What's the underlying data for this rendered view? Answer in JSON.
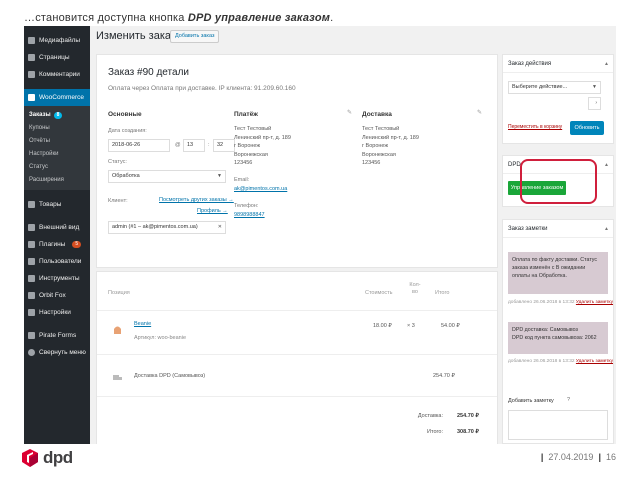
{
  "caption": {
    "prefix": "…становится доступна кнопка ",
    "emphasis": "DPD управление заказом",
    "suffix": "."
  },
  "sidebar": {
    "items": [
      {
        "label": "Медиафайлы",
        "icon": "media-icon"
      },
      {
        "label": "Страницы",
        "icon": "page-icon"
      },
      {
        "label": "Комментарии",
        "icon": "comment-icon"
      },
      {
        "label": "WooCommerce",
        "icon": "woocommerce-icon"
      }
    ],
    "submenu": [
      {
        "label": "Заказы",
        "badge": "8"
      },
      {
        "label": "Купоны"
      },
      {
        "label": "Отчёты"
      },
      {
        "label": "Настройки"
      },
      {
        "label": "Статус"
      },
      {
        "label": "Расширения"
      }
    ],
    "items2": [
      {
        "label": "Товары",
        "icon": "products-icon"
      },
      {
        "label": "Внешний вид",
        "icon": "appearance-icon"
      },
      {
        "label": "Плагины",
        "icon": "plugins-icon",
        "badge": "5"
      },
      {
        "label": "Пользователи",
        "icon": "users-icon"
      },
      {
        "label": "Инструменты",
        "icon": "tools-icon"
      },
      {
        "label": "Orbit Fox",
        "icon": "orbitfox-icon"
      },
      {
        "label": "Настройки",
        "icon": "settings-icon"
      },
      {
        "label": "Pirate Forms",
        "icon": "pirateforms-icon"
      },
      {
        "label": "Свернуть меню",
        "icon": "collapse-icon"
      }
    ]
  },
  "header": {
    "title": "Изменить заказ",
    "add_button": "Добавить заказ"
  },
  "order": {
    "title": "Заказ #90 детали",
    "subtitle": "Оплата через Оплата при доставке. IP клиента: 91.209.60.160",
    "basic": {
      "heading": "Основные",
      "date_label": "Дата создания:",
      "date": "2018-06-26",
      "at": "@",
      "hour": "13",
      "colon": ":",
      "minute": "32",
      "status_label": "Статус:",
      "status": "Обработка",
      "client_label": "Клиент:",
      "client_link1": "Посмотреть других заказы →",
      "client_link2": "Профиль →",
      "client": "admin (#1 – ak@pimentos.com.ua)"
    },
    "billing": {
      "heading": "Платёж",
      "address": "Тест Тестовый\nЛенинский пр-т, д. 189\nг Воронеж\nВоронежская\n123456",
      "email_label": "Email:",
      "email": "ak@pimentos.com.ua",
      "phone_label": "Телефон:",
      "phone": "9898988847"
    },
    "shipping": {
      "heading": "Доставка",
      "address": "Тест Тестовый\nЛенинский пр-т, д. 189\nг Воронеж\nВоронежская\n123456"
    }
  },
  "items": {
    "col_position": "Позиция",
    "col_cost": "Стоимость",
    "col_qty": "Кол-\nво",
    "col_total": "Итого",
    "product_name": "Beanie",
    "product_sku": "Артикул: woo-beanie",
    "product_cost": "18.00 ₽",
    "product_qty": "× 3",
    "product_total": "54.00 ₽",
    "shipping_name": "Доставка DPD (Самовывоз)",
    "shipping_total": "254.70 ₽",
    "delivery_label": "Доставка:",
    "delivery_value": "254.70 ₽",
    "total_label": "Итого:",
    "total_value": "308.70 ₽"
  },
  "actions_box": {
    "title": "Заказ действия",
    "select": "Выберите действие...",
    "trash_link": "Переместить в корзину",
    "update_button": "Обновить"
  },
  "dpd_box": {
    "title": "DPD",
    "button": "Управление заказом"
  },
  "notes_box": {
    "title": "Заказ заметки",
    "notes": [
      {
        "text": "Оплата по факту доставки. Статус заказа изменён с В ожидании оплаты на Обработка.",
        "meta": "добавлено 26.06.2018 в 13:32",
        "delete": "Удалить заметку"
      },
      {
        "text": "DPD доставка: Самовывоз\nDPD код пункта самовывоза: 2062",
        "meta": "добавлено 26.06.2018 в 13:32",
        "delete": "Удалить заметку"
      }
    ],
    "add_label": "Добавить заметку"
  },
  "footer": {
    "brand": "dpd",
    "date": "27.04.2019",
    "page": "16",
    "separator": "|"
  },
  "colors": {
    "wp_dark": "#23282d",
    "wp_blue": "#0073aa",
    "green": "#1aa639",
    "highlight": "#d01f3c",
    "dpd_red": "#dc0032"
  }
}
